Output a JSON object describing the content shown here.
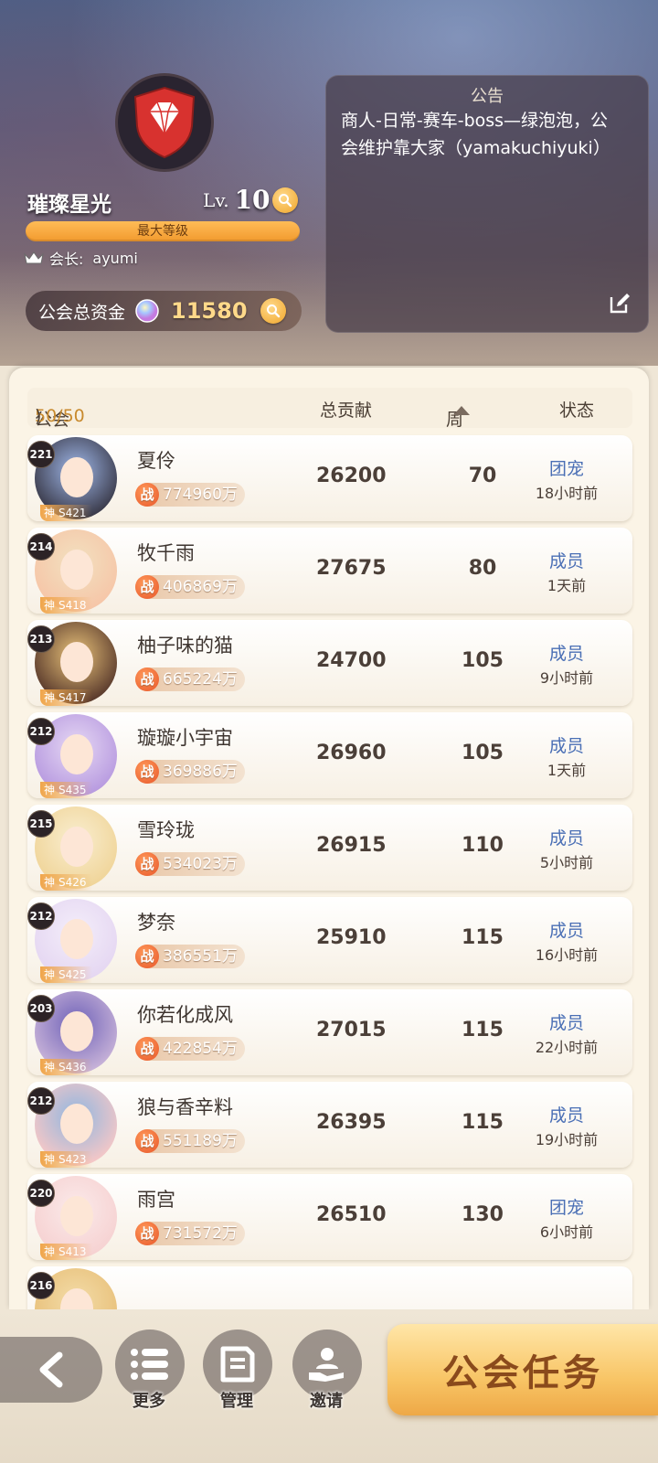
{
  "guild": {
    "name": "璀璨星光",
    "level_prefix": "Lv.",
    "level": "10",
    "max_level_text": "最大等级",
    "leader_label": "会长:",
    "leader_name": "ayumi",
    "funds_label": "公会总资金",
    "funds_value": "11580"
  },
  "notice": {
    "title": "公告",
    "text": "商人-日常-赛车-boss—绿泡泡，公会维护靠大家（yamakuchiyuki）"
  },
  "table_header": {
    "members_label": "公会成员：(",
    "members_count": "50/50",
    "members_close": ")",
    "total_label": "总贡献",
    "weekly_label": "周贡献",
    "status_label": "状态"
  },
  "members": [
    {
      "level": "221",
      "server": "S421",
      "name": "夏伶",
      "power": "774960万",
      "total": "26200",
      "weekly": "70",
      "role": "团宠",
      "last_seen": "18小时前"
    },
    {
      "level": "214",
      "server": "S418",
      "name": "牧千雨",
      "power": "406869万",
      "total": "27675",
      "weekly": "80",
      "role": "成员",
      "last_seen": "1天前"
    },
    {
      "level": "213",
      "server": "S417",
      "name": "柚子味的猫",
      "power": "665224万",
      "total": "24700",
      "weekly": "105",
      "role": "成员",
      "last_seen": "9小时前"
    },
    {
      "level": "212",
      "server": "S435",
      "name": "璇璇小宇宙",
      "power": "369886万",
      "total": "26960",
      "weekly": "105",
      "role": "成员",
      "last_seen": "1天前"
    },
    {
      "level": "215",
      "server": "S426",
      "name": "雪玲珑",
      "power": "534023万",
      "total": "26915",
      "weekly": "110",
      "role": "成员",
      "last_seen": "5小时前"
    },
    {
      "level": "212",
      "server": "S425",
      "name": "梦奈",
      "power": "386551万",
      "total": "25910",
      "weekly": "115",
      "role": "成员",
      "last_seen": "16小时前"
    },
    {
      "level": "203",
      "server": "S436",
      "name": "你若化成风",
      "power": "422854万",
      "total": "27015",
      "weekly": "115",
      "role": "成员",
      "last_seen": "22小时前"
    },
    {
      "level": "212",
      "server": "S423",
      "name": "狼与香辛料",
      "power": "551189万",
      "total": "26395",
      "weekly": "115",
      "role": "成员",
      "last_seen": "19小时前"
    },
    {
      "level": "220",
      "server": "S413",
      "name": "雨宫",
      "power": "731572万",
      "total": "26510",
      "weekly": "130",
      "role": "团宠",
      "last_seen": "6小时前"
    },
    {
      "level": "216"
    }
  ],
  "power_glyph": "战",
  "bottom_nav": {
    "more_label": "更多",
    "manage_label": "管理",
    "invite_label": "邀请",
    "task_label": "公会任务"
  },
  "colors": {
    "accent_orange": "#f29a2e",
    "role_blue": "#4a6fb5",
    "emblem_red": "#d8322f"
  }
}
